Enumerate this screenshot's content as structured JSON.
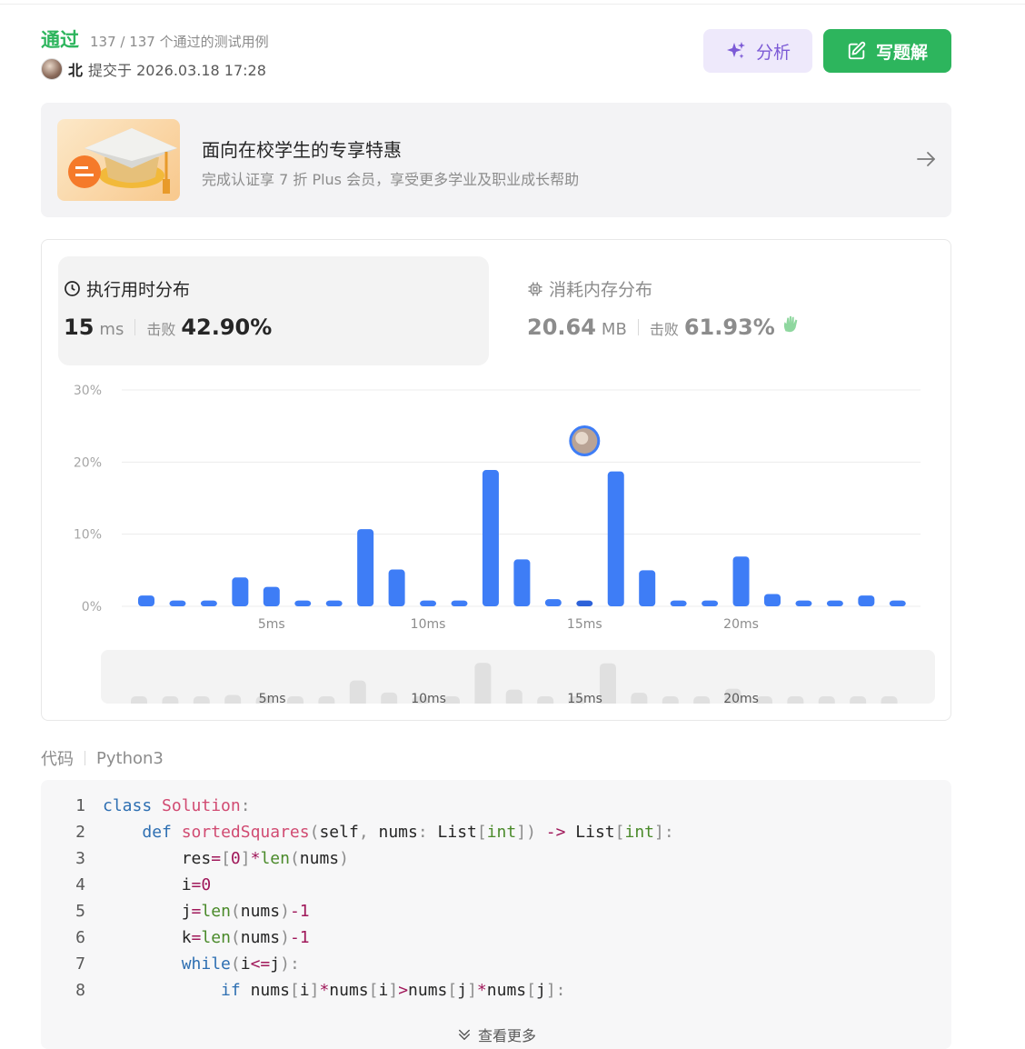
{
  "header": {
    "status": "通过",
    "count_text": "137 / 137 个通过的测试用例",
    "user_name": "北",
    "submit_text": "提交于 2026.03.18 17:28",
    "analyze_label": "分析",
    "solution_label": "写题解"
  },
  "promo": {
    "title": "面向在校学生的专享特惠",
    "subtitle": "完成认证享 7 折 Plus 会员，享受更多学业及职业成长帮助"
  },
  "runtime": {
    "title": "执行用时分布",
    "value": "15",
    "unit": "ms",
    "beat_label": "击败",
    "beat_value": "42.90%"
  },
  "memory": {
    "title": "消耗内存分布",
    "value": "20.64",
    "unit": "MB",
    "beat_label": "击败",
    "beat_value": "61.93%"
  },
  "chart_data": {
    "type": "bar",
    "ytick_labels": [
      "30%",
      "20%",
      "10%",
      "0%"
    ],
    "yticks": [
      30,
      20,
      10,
      0
    ],
    "ylim": [
      0,
      30
    ],
    "xtick_labels": [
      "5ms",
      "10ms",
      "15ms",
      "20ms"
    ],
    "xtick_positions": [
      5,
      10,
      15,
      20
    ],
    "x": [
      1,
      2,
      3,
      4,
      5,
      6,
      7,
      8,
      9,
      10,
      11,
      12,
      13,
      14,
      15,
      16,
      17,
      18,
      19,
      20,
      21,
      22,
      23,
      24,
      25,
      26
    ],
    "values": [
      1.5,
      0.8,
      0.8,
      4.0,
      2.7,
      0.8,
      0.8,
      10.7,
      5.1,
      0.8,
      0.8,
      18.9,
      6.5,
      1.0,
      0.8,
      18.7,
      5.0,
      0.8,
      0.8,
      6.9,
      1.7,
      0.8,
      0.8,
      1.5,
      0.8
    ],
    "highlight_x": 15,
    "color": "#3e7df6",
    "highlight_color": "#2d62d9",
    "grid": true,
    "overview_labels": [
      "5ms",
      "10ms",
      "15ms",
      "20ms"
    ]
  },
  "code": {
    "label": "代码",
    "language": "Python3",
    "more_label": "查看更多"
  },
  "colors": {
    "accept": "#2db55d",
    "analyze_bg": "#eee9fb",
    "analyze_fg": "#7c5ad6"
  }
}
